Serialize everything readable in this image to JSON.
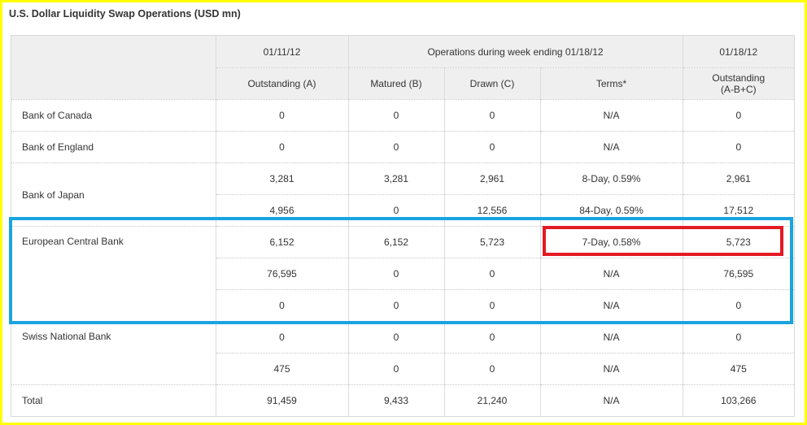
{
  "title": "U.S. Dollar Liquidity Swap Operations (USD mn)",
  "header": {
    "date_left": "01/11/12",
    "week_label": "Operations during week ending 01/18/12",
    "date_right": "01/18/12",
    "col_outstanding_a": "Outstanding (A)",
    "col_matured_b": "Matured (B)",
    "col_drawn_c": "Drawn (C)",
    "col_terms": "Terms*",
    "col_outstanding_line1": "Outstanding",
    "col_outstanding_line2": "(A-B+C)"
  },
  "banks": {
    "canada": "Bank of Canada",
    "england": "Bank of England",
    "japan": "Bank of Japan",
    "ecb": "European Central Bank",
    "snb": "Swiss National Bank",
    "total": "Total"
  },
  "rows": [
    {
      "a": "0",
      "b": "0",
      "c": "0",
      "terms": "N/A",
      "out": "0"
    },
    {
      "a": "0",
      "b": "0",
      "c": "0",
      "terms": "N/A",
      "out": "0"
    },
    {
      "a": "3,281",
      "b": "3,281",
      "c": "2,961",
      "terms": "8-Day, 0.59%",
      "out": "2,961"
    },
    {
      "a": "4,956",
      "b": "0",
      "c": "12,556",
      "terms": "84-Day, 0.59%",
      "out": "17,512"
    },
    {
      "a": "6,152",
      "b": "6,152",
      "c": "5,723",
      "terms": "7-Day, 0.58%",
      "out": "5,723"
    },
    {
      "a": "76,595",
      "b": "0",
      "c": "0",
      "terms": "N/A",
      "out": "76,595"
    },
    {
      "a": "0",
      "b": "0",
      "c": "0",
      "terms": "N/A",
      "out": "0"
    },
    {
      "a": "0",
      "b": "0",
      "c": "0",
      "terms": "N/A",
      "out": "0"
    },
    {
      "a": "475",
      "b": "0",
      "c": "0",
      "terms": "N/A",
      "out": "475"
    },
    {
      "a": "91,459",
      "b": "9,433",
      "c": "21,240",
      "terms": "N/A",
      "out": "103,266"
    }
  ],
  "highlight_colors": {
    "outer": "#ffff00",
    "group": "#1aa4e0",
    "cell": "#e41a24"
  }
}
